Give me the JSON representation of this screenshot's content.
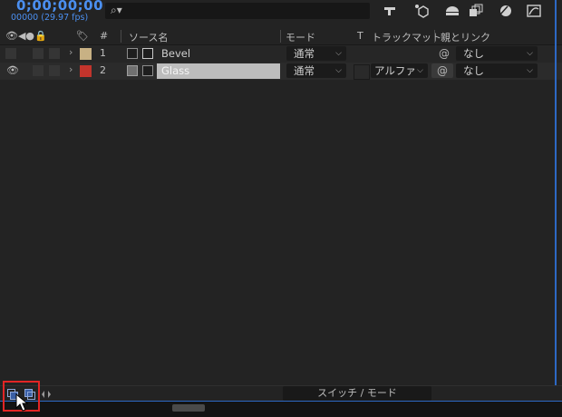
{
  "timecode": {
    "time": "0;00;00;00",
    "frames": "00000 (29.97 fps)"
  },
  "search": {
    "placeholder": ""
  },
  "header": {
    "hash": "#",
    "source_name": "ソース名",
    "mode": "モード",
    "t": "T",
    "track_matte": "トラックマット",
    "parent_link": "親とリンク"
  },
  "layers": [
    {
      "number": "1",
      "name": "Bevel",
      "mode": "通常",
      "track_matte": "",
      "parent": "なし",
      "label_color": "#c8b184"
    },
    {
      "number": "2",
      "name": "Glass",
      "mode": "通常",
      "track_matte": "アルファ",
      "parent": "なし",
      "label_color": "#c2342c"
    }
  ],
  "bottom": {
    "switch_mode_label": "スイッチ / モード"
  },
  "colors": {
    "accent": "#4b8ff0",
    "highlight": "#e32525"
  }
}
